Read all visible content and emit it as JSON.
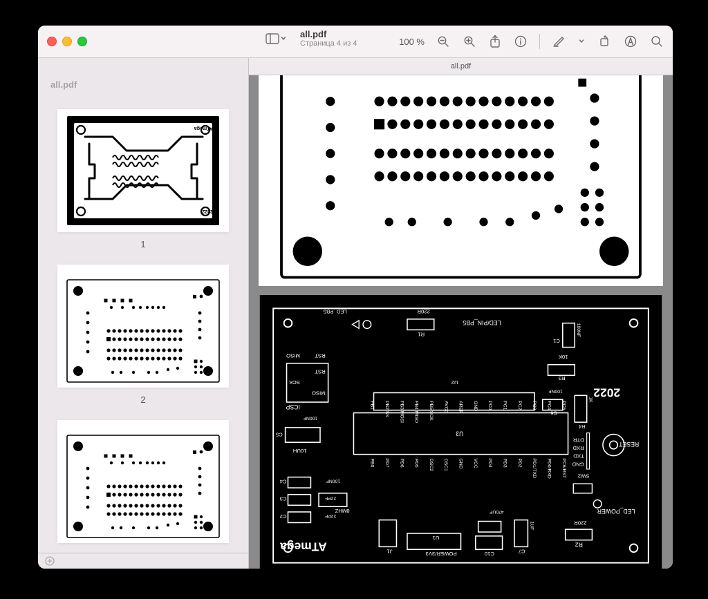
{
  "header": {
    "filename": "all.pdf",
    "page_status": "Страница 4 из 4",
    "zoom": "100 %"
  },
  "tabbar": {
    "active_tab": "all.pdf"
  },
  "sidebar": {
    "doc_label": "all.pdf",
    "thumbnails": [
      {
        "num": "1"
      },
      {
        "num": "2"
      }
    ]
  },
  "pcb": {
    "title_text": "ATmega",
    "year": "2022",
    "components": {
      "R1": "R1",
      "R2": "R2",
      "R3": "R3",
      "R4": "R4",
      "C1": "C1",
      "C2": "C2",
      "C3": "C3",
      "C4": "C4",
      "C5": "C5",
      "C6": "C6",
      "C7": "C7",
      "C10": "C10",
      "U1": "U1",
      "U2": "U2",
      "U3": "U3",
      "SW2": "SW2",
      "J1": "J1"
    },
    "values": {
      "V_220R_a": "220R",
      "V_220R_b": "220R",
      "V_10K": "10K",
      "V_1K": "1K",
      "V_470UF": "470UF",
      "V_1UF": "1UF",
      "V_100NF_a": "100NF",
      "V_100NF_b": "100NF",
      "V_100NF_c": "100NF",
      "V_100NF_d": "100NF",
      "V_10UH": "10UH",
      "V_22PF_a": "22PF",
      "V_22PF_b": "22PF",
      "V_8MHZ": "8MHZ",
      "V_POWER": "POWER/3V3"
    },
    "labels": {
      "LED_POWER": "LED_POWER",
      "RESET": "RESET",
      "ICSP": "ICSP",
      "MISO": "MISO",
      "SCK": "SCK",
      "RST": "RST",
      "MISO2": "MISO",
      "RST2": "RST",
      "LED_PB5": "LED_PB5",
      "LED_PIN_PB5": "LED/PIN_PB5"
    },
    "serial_header": [
      "GND",
      "TXD",
      "RXD",
      "DTR"
    ],
    "u3_pins_top": [
      "PC6/RST",
      "PD0/RXD",
      "PD1/TXD",
      "PD2",
      "PD3",
      "PD4",
      "VCC",
      "GND",
      "OSC1",
      "OSC2",
      "PD5",
      "PD6",
      "PD7",
      "PB0"
    ],
    "u3_pins_bot": [
      "PB1",
      "PB2/SS",
      "PB3/MOSI",
      "PB4/MISO",
      "PB5/SCK",
      "AVCC",
      "AREF",
      "GND",
      "PC0",
      "PC1",
      "PC2",
      "PC3",
      "PC4",
      "PC5"
    ]
  }
}
